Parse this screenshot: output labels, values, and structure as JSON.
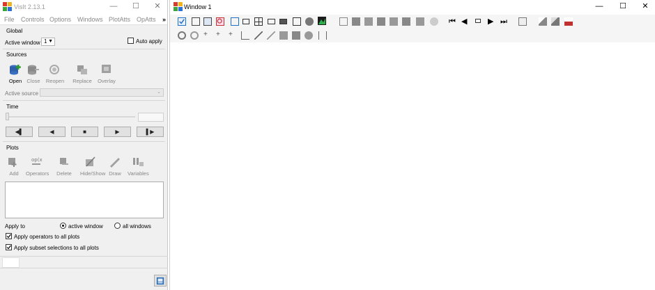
{
  "gui_window": {
    "title": "VisIt 2.13.1",
    "menu": [
      "File",
      "Controls",
      "Options",
      "Windows",
      "PlotAtts",
      "OpAtts"
    ],
    "menu_overflow": "»",
    "global": {
      "label": "Global",
      "active_window_label": "Active window",
      "active_window_value": "1",
      "auto_apply_label": "Auto apply",
      "auto_apply_checked": false
    },
    "sources": {
      "label": "Sources",
      "buttons": [
        "Open",
        "Close",
        "Reopen",
        "Replace",
        "Overlay"
      ],
      "active_source_label": "Active source",
      "active_source_value": ""
    },
    "time": {
      "label": "Time",
      "controls": [
        "◀▌",
        "◀",
        "■",
        "▶",
        "▌▶"
      ]
    },
    "plots": {
      "label": "Plots",
      "buttons": [
        "Add",
        "Operators",
        "Delete",
        "Hide/Show",
        "Draw",
        "Variables"
      ],
      "apply_to_label": "Apply to",
      "apply_to_options": [
        "active window",
        "all windows"
      ],
      "apply_to_selected": "active window",
      "apply_operators_label": "Apply operators to all plots",
      "apply_operators_checked": true,
      "apply_subset_label": "Apply subset selections to all plots",
      "apply_subset_checked": true
    }
  },
  "viewer_window": {
    "title": "Window 1"
  },
  "colors": {
    "accent": "#1e6fc8",
    "button_bg": "#e1e1e1",
    "panel_bg": "#f0f0f0"
  }
}
